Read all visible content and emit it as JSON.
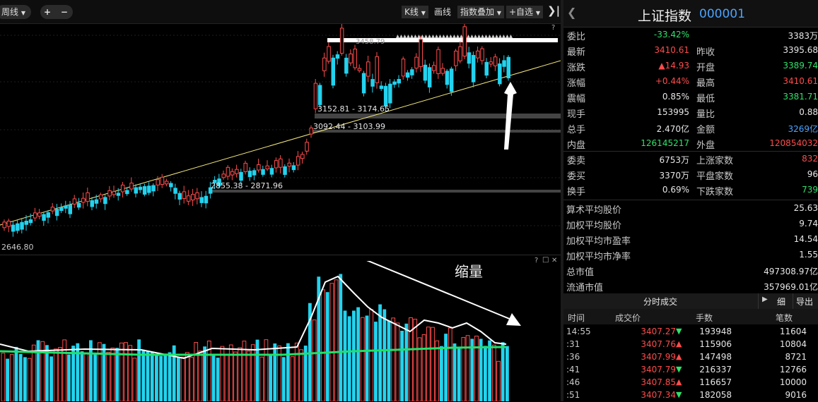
{
  "toolbar": {
    "period": "周线",
    "plus": "+",
    "minus": "−",
    "kline": "K线",
    "draw": "画线",
    "overlay": "指数叠加",
    "watchlist": "+自选",
    "help": "?"
  },
  "chart": {
    "top_label": "3458.79",
    "low_label": "2646.80",
    "range1": "3152.81 - 3174.65",
    "range2": "3092.44 - 3103.99",
    "range3": "2855.38 - 2871.96",
    "annotation": "缩量",
    "vol_help": "?",
    "vol_restore": "□",
    "vol_close": "✕"
  },
  "quote": {
    "name": "上证指数",
    "code": "000001",
    "rows": [
      {
        "l1": "委比",
        "v1": "-33.42%",
        "c1": "green",
        "l2": "",
        "v2": "3383万",
        "c2": "white"
      },
      {
        "l1": "最新",
        "v1": "3410.61",
        "c1": "red",
        "l2": "昨收",
        "v2": "3395.68",
        "c2": "white"
      },
      {
        "l1": "涨跌",
        "v1": "▲14.93",
        "c1": "red",
        "l2": "开盘",
        "v2": "3389.74",
        "c2": "green"
      },
      {
        "l1": "涨幅",
        "v1": "+0.44%",
        "c1": "red",
        "l2": "最高",
        "v2": "3410.61",
        "c2": "red"
      },
      {
        "l1": "震幅",
        "v1": "0.85%",
        "c1": "white",
        "l2": "最低",
        "v2": "3381.71",
        "c2": "green"
      },
      {
        "l1": "现手",
        "v1": "153995",
        "c1": "white",
        "l2": "量比",
        "v2": "0.88",
        "c2": "white"
      },
      {
        "l1": "总手",
        "v1": "2.470亿",
        "c1": "white",
        "l2": "金额",
        "v2": "3269亿",
        "c2": "blue"
      },
      {
        "l1": "内盘",
        "v1": "126145217",
        "c1": "green",
        "l2": "外盘",
        "v2": "120854032",
        "c2": "red"
      },
      {
        "l1": "委卖",
        "v1": "6753万",
        "c1": "white",
        "l2": "上涨家数",
        "v2": "832",
        "c2": "red"
      },
      {
        "l1": "委买",
        "v1": "3370万",
        "c1": "white",
        "l2": "平盘家数",
        "v2": "96",
        "c2": "white"
      },
      {
        "l1": "换手",
        "v1": "0.69%",
        "c1": "white",
        "l2": "下跌家数",
        "v2": "739",
        "c2": "green"
      }
    ],
    "stats": [
      {
        "l": "算术平均股价",
        "v": "25.63"
      },
      {
        "l": "加权平均股价",
        "v": "9.74"
      },
      {
        "l": "加权平均市盈率",
        "v": "14.54"
      },
      {
        "l": "加权平均市净率",
        "v": "1.55"
      },
      {
        "l": "总市值",
        "v": "497308.97亿"
      },
      {
        "l": "流通市值",
        "v": "357969.01亿"
      }
    ]
  },
  "trades": {
    "tab": "分时成交",
    "detail": "细",
    "export": "导出",
    "headers": [
      "时间",
      "成交价",
      "手数",
      "笔数"
    ],
    "rows": [
      {
        "time": "14:55",
        "price": "3407.27",
        "dir": "▼",
        "dirc": "green",
        "vol": "193948",
        "cnt": "11604"
      },
      {
        "time": ":31",
        "price": "3407.76",
        "dir": "▲",
        "dirc": "red",
        "vol": "115906",
        "cnt": "10804"
      },
      {
        "time": ":36",
        "price": "3407.99",
        "dir": "▲",
        "dirc": "red",
        "vol": "147498",
        "cnt": "8721"
      },
      {
        "time": ":41",
        "price": "3407.79",
        "dir": "▼",
        "dirc": "green",
        "vol": "216337",
        "cnt": "12766"
      },
      {
        "time": ":46",
        "price": "3407.85",
        "dir": "▲",
        "dirc": "red",
        "vol": "116657",
        "cnt": "10000"
      },
      {
        "time": ":51",
        "price": "3407.34",
        "dir": "▼",
        "dirc": "green",
        "vol": "182058",
        "cnt": "9016"
      }
    ]
  },
  "colors": {
    "up": "#ff4b4b",
    "down": "#22d3ee",
    "ma": "#1fe26a",
    "trend": "#f5e97a"
  }
}
